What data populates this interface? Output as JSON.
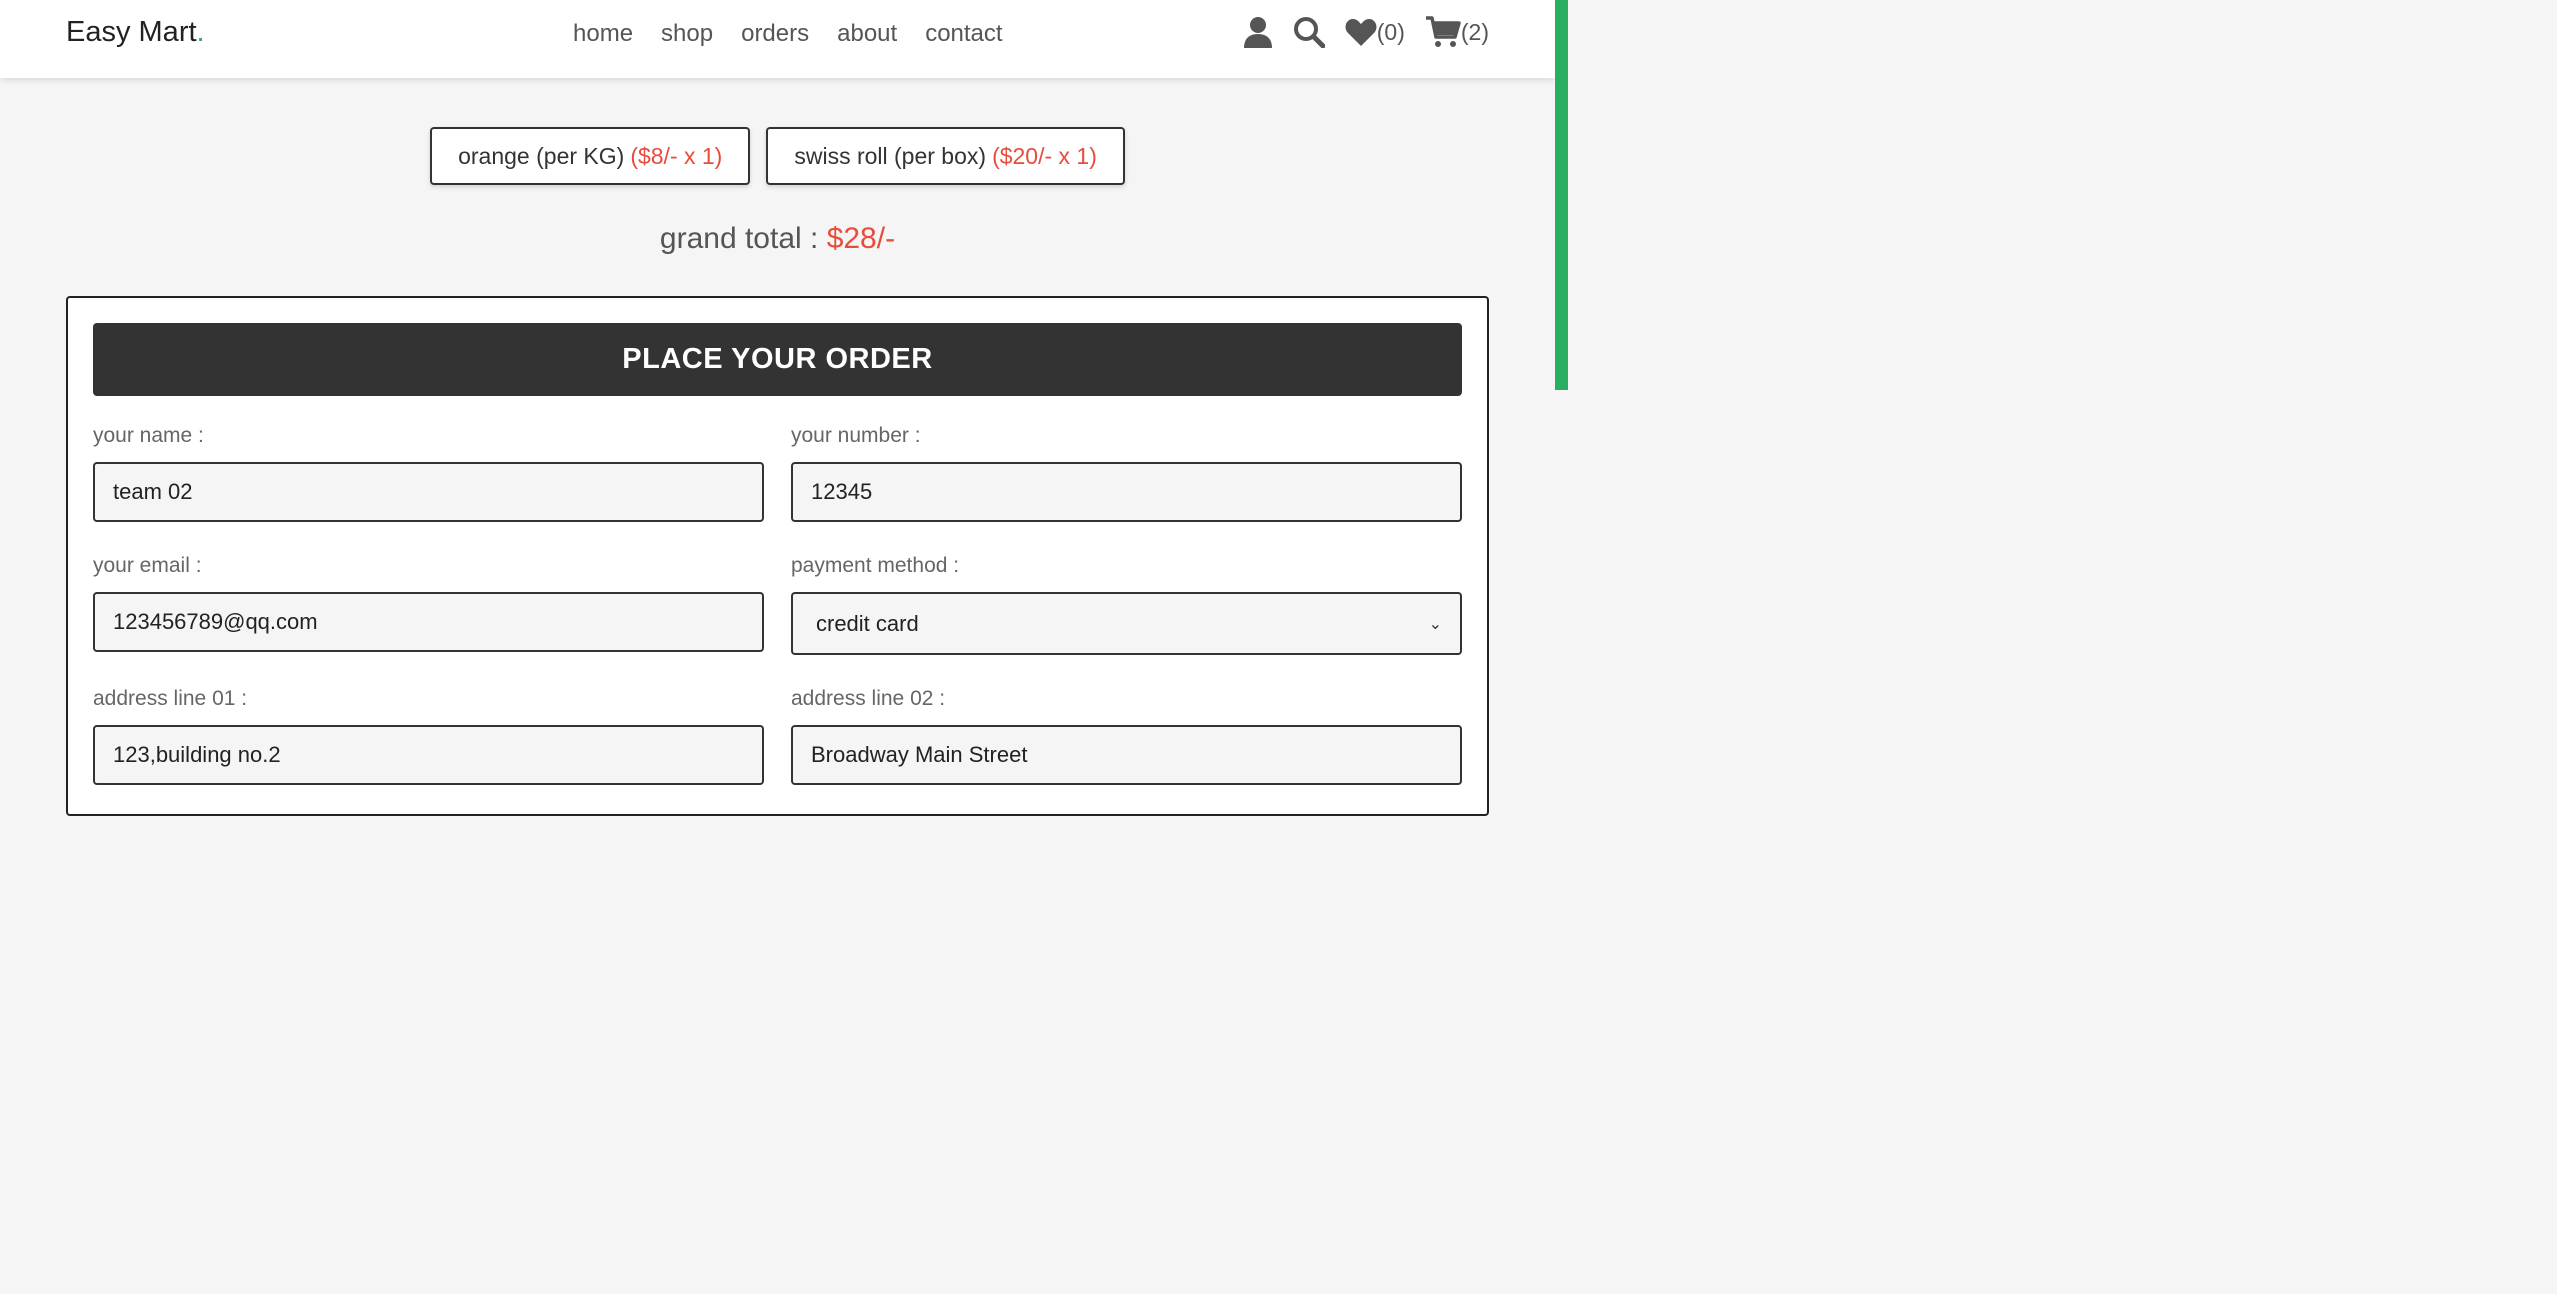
{
  "brand": {
    "name": "Easy Mart",
    "dot": "."
  },
  "nav": [
    "home",
    "shop",
    "orders",
    "about",
    "contact"
  ],
  "header_icons": {
    "user": "user-icon",
    "search": "search-icon",
    "wishlist": {
      "icon": "heart-icon",
      "count": "(0)"
    },
    "cart": {
      "icon": "cart-icon",
      "count": "(2)"
    }
  },
  "cart_items": [
    {
      "name": "orange (per KG)",
      "price": "($8/- x 1)"
    },
    {
      "name": "swiss roll (per box)",
      "price": "($20/- x 1)"
    }
  ],
  "grand_total": {
    "label": "grand total :",
    "amount": "$28/-"
  },
  "form": {
    "title": "PLACE YOUR ORDER",
    "name": {
      "label": "your name :",
      "value": "team 02"
    },
    "number": {
      "label": "your number :",
      "value": "12345"
    },
    "email": {
      "label": "your email :",
      "value": "123456789@qq.com"
    },
    "payment": {
      "label": "payment method :",
      "value": "credit card"
    },
    "address1": {
      "label": "address line 01 :",
      "value": "123,building no.2"
    },
    "address2": {
      "label": "address line 02 :",
      "value": "Broadway Main Street"
    }
  },
  "colors": {
    "accent": "#27ae60",
    "price": "#e74c3c",
    "dark": "#333333"
  }
}
